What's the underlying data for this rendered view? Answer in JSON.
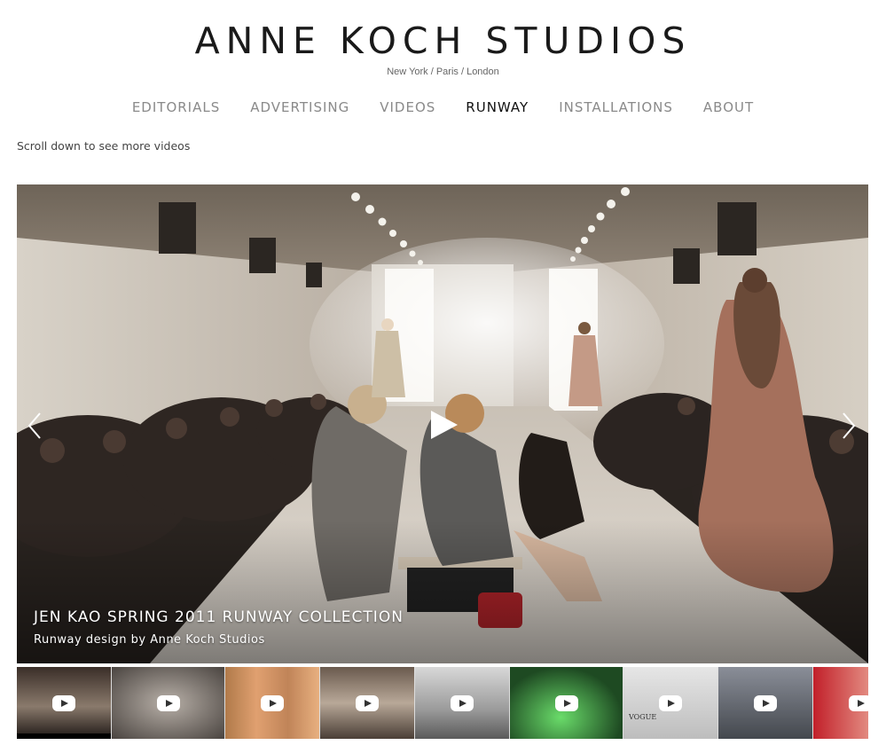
{
  "site": {
    "brand": "ANNE KOCH STUDIOS",
    "tagline": "New York / Paris / London"
  },
  "nav": {
    "items": [
      {
        "label": "EDITORIALS"
      },
      {
        "label": "ADVERTISING"
      },
      {
        "label": "VIDEOS"
      },
      {
        "label": "RUNWAY",
        "active": true
      },
      {
        "label": "INSTALLATIONS"
      },
      {
        "label": "ABOUT"
      }
    ]
  },
  "hint": "Scroll down to see more videos",
  "video": {
    "title": "JEN KAO SPRING 2011 RUNWAY COLLECTION",
    "subtitle": "Runway design by Anne Koch Studios"
  },
  "thumbnails": [
    {
      "name": "thumb-1",
      "active": true
    },
    {
      "name": "thumb-2"
    },
    {
      "name": "thumb-3"
    },
    {
      "name": "thumb-4"
    },
    {
      "name": "thumb-5"
    },
    {
      "name": "thumb-6"
    },
    {
      "name": "thumb-7",
      "logo": "VOGUE"
    },
    {
      "name": "thumb-8"
    },
    {
      "name": "thumb-9"
    }
  ],
  "icons": {
    "play": "play-icon",
    "prev": "chevron-left-icon",
    "next": "chevron-right-icon",
    "thumb_play": "youtube-play-icon"
  },
  "colors": {
    "background": "#ffffff",
    "nav_inactive": "#8a8a8a",
    "nav_active": "#111111"
  }
}
